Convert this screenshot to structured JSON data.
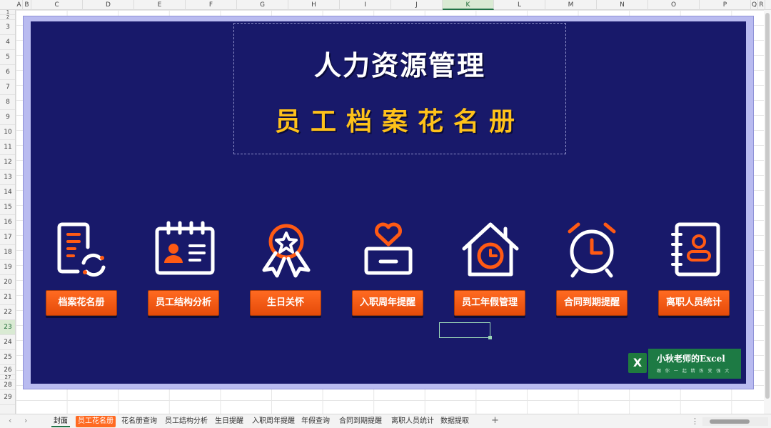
{
  "columns": [
    "A",
    "B",
    "C",
    "D",
    "E",
    "F",
    "G",
    "H",
    "I",
    "J",
    "K",
    "L",
    "M",
    "N",
    "O",
    "P",
    "Q",
    "R"
  ],
  "active_column": "K",
  "rows": [
    "1",
    "2",
    "3",
    "4",
    "5",
    "6",
    "7",
    "8",
    "9",
    "10",
    "11",
    "12",
    "13",
    "14",
    "15",
    "16",
    "17",
    "18",
    "19",
    "20",
    "21",
    "22",
    "23",
    "24",
    "25",
    "26",
    "27",
    "28",
    "29"
  ],
  "active_row": "23",
  "banner": {
    "title": "人力资源管理",
    "subtitle": "员工档案花名册",
    "accent_color": "#ff5a14",
    "background_color": "#18196a",
    "title_color": "#ffffff",
    "subtitle_color": "#ffc21a"
  },
  "nav": [
    {
      "label": "档案花名册",
      "icon": "document-cycle-icon"
    },
    {
      "label": "员工结构分析",
      "icon": "id-card-calendar-icon"
    },
    {
      "label": "生日关怀",
      "icon": "award-ribbon-star-icon"
    },
    {
      "label": "入职周年提醒",
      "icon": "heart-box-icon"
    },
    {
      "label": "员工年假管理",
      "icon": "house-clock-icon"
    },
    {
      "label": "合同到期提醒",
      "icon": "alarm-clock-icon"
    },
    {
      "label": "离职人员统计",
      "icon": "contact-book-person-icon"
    }
  ],
  "logo": {
    "text": "小秋老师的Excel",
    "sub": "跟 你 一 起 精 炼 变 强 大"
  },
  "sheet_tabs": [
    "封面",
    "员工花名册",
    "花名册查询",
    "员工结构分析",
    "生日提醒",
    "入职周年提醒",
    "年假查询",
    "合同到期提醒",
    "离职人员统计",
    "数据提取"
  ],
  "active_tab": "封面",
  "highlight_tab": "员工花名册",
  "tab_add": "+",
  "tab_more": "⋮",
  "tab_prev": "‹",
  "tab_next": "›"
}
